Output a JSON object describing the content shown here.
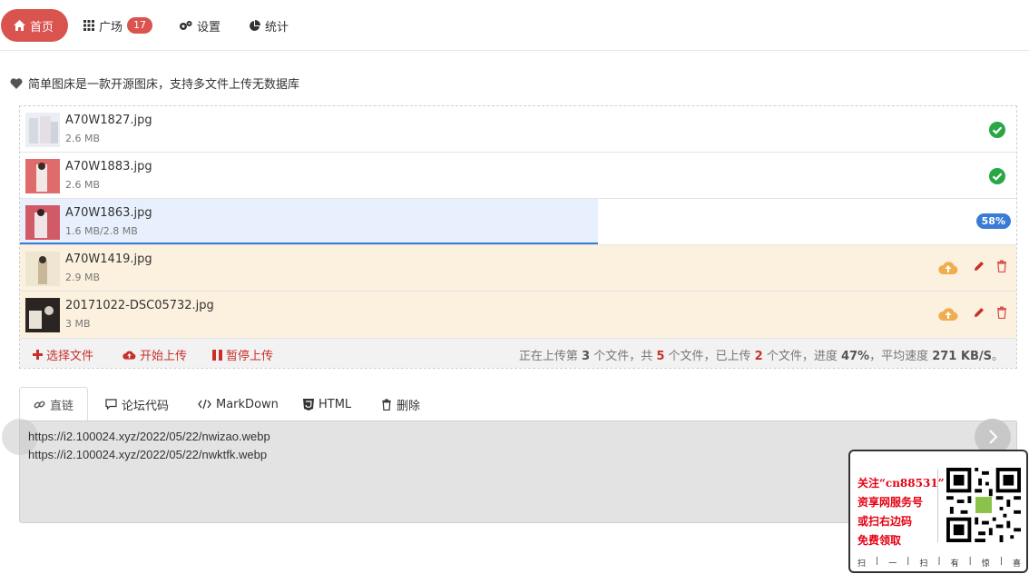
{
  "nav": {
    "home": "首页",
    "plaza": "广场",
    "plaza_count": "17",
    "settings": "设置",
    "stats": "统计"
  },
  "intro": "简单图床是一款开源图床，支持多文件上传无数据库",
  "files": [
    {
      "name": "A70W1827.jpg",
      "size": "2.6 MB",
      "state": "done"
    },
    {
      "name": "A70W1883.jpg",
      "size": "2.6 MB",
      "state": "done"
    },
    {
      "name": "A70W1863.jpg",
      "size": "1.6 MB/2.8 MB",
      "state": "uploading",
      "percent_label": "58%",
      "progress": 0.58
    },
    {
      "name": "A70W1419.jpg",
      "size": "2.9 MB",
      "state": "pending"
    },
    {
      "name": "20171022-DSC05732.jpg",
      "size": "3 MB",
      "state": "pending"
    }
  ],
  "toolbar": {
    "select": "选择文件",
    "start": "开始上传",
    "pause": "暂停上传",
    "status_1": "正在上传第 ",
    "current": "3",
    "status_2": " 个文件，共 ",
    "total": "5",
    "status_3": " 个文件，已上传 ",
    "uploaded": "2",
    "status_4": " 个文件，进度 ",
    "progress": "47%",
    "status_5": "，平均速度 ",
    "speed": "271 KB/S",
    "status_6": "。"
  },
  "tabs": [
    "直链",
    "论坛代码",
    "MarkDown",
    "HTML",
    "删除"
  ],
  "links": [
    "https://i2.100024.xyz/2022/05/22/nwizao.webp",
    "https://i2.100024.xyz/2022/05/22/nwktfk.webp"
  ],
  "promo": {
    "line1": "关注“cn88531”",
    "line2": "资享网服务号",
    "line3": "或扫右边码",
    "line4": "免费领取",
    "footer": [
      "扫",
      "|",
      "一",
      "|",
      "扫",
      "|",
      "有",
      "|",
      "惊",
      "|",
      "喜"
    ]
  },
  "colors": {
    "accent": "#d9534f",
    "success": "#28a745",
    "progress": "#3a7bd5",
    "upload_icon": "#f0ad4e",
    "pending_bg": "#fcf1de"
  }
}
